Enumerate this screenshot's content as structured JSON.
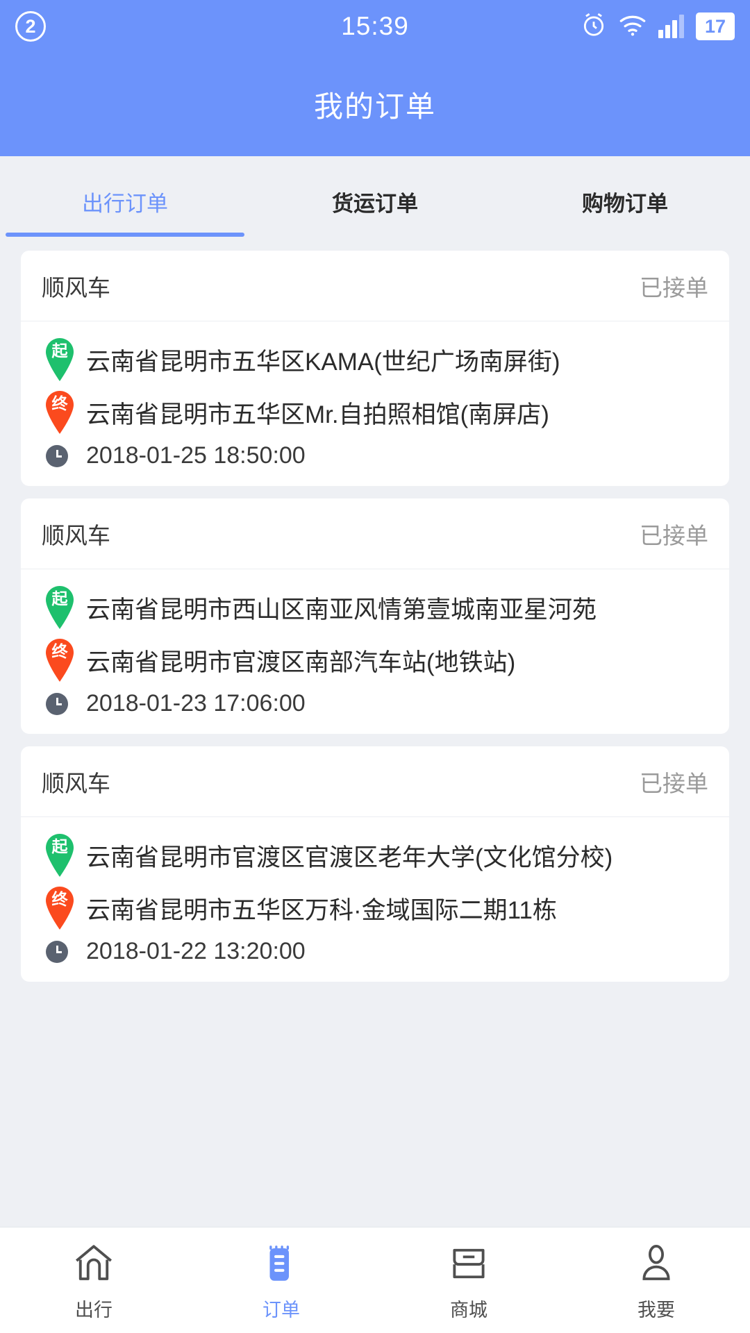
{
  "colors": {
    "brand": "#6c93fb",
    "page_bg": "#eef0f4",
    "card_bg": "#ffffff",
    "start_pin": "#1ec06d",
    "end_pin": "#fb4a1e",
    "muted_text": "#9a9a9a"
  },
  "statusbar": {
    "notification_count": "2",
    "time": "15:39",
    "battery": "17",
    "icons": [
      "alarm-icon",
      "wifi-icon",
      "signal-icon",
      "battery-icon"
    ]
  },
  "header": {
    "title": "我的订单"
  },
  "tabs": [
    {
      "label": "出行订单",
      "active": true
    },
    {
      "label": "货运订单",
      "active": false
    },
    {
      "label": "购物订单",
      "active": false
    }
  ],
  "orders": [
    {
      "type": "顺风车",
      "status": "已接单",
      "start_badge": "起",
      "end_badge": "终",
      "start_address": "云南省昆明市五华区KAMA(世纪广场南屏街)",
      "end_address": "云南省昆明市五华区Mr.自拍照相馆(南屏店)",
      "time": "2018-01-25 18:50:00"
    },
    {
      "type": "顺风车",
      "status": "已接单",
      "start_badge": "起",
      "end_badge": "终",
      "start_address": "云南省昆明市西山区南亚风情第壹城南亚星河苑",
      "end_address": "云南省昆明市官渡区南部汽车站(地铁站)",
      "time": "2018-01-23 17:06:00"
    },
    {
      "type": "顺风车",
      "status": "已接单",
      "start_badge": "起",
      "end_badge": "终",
      "start_address": "云南省昆明市官渡区官渡区老年大学(文化馆分校)",
      "end_address": "云南省昆明市五华区万科·金域国际二期11栋",
      "time": "2018-01-22 13:20:00"
    }
  ],
  "bottomnav": [
    {
      "label": "出行",
      "icon": "home-icon",
      "active": false
    },
    {
      "label": "订单",
      "icon": "order-list-icon",
      "active": true
    },
    {
      "label": "商城",
      "icon": "store-icon",
      "active": false
    },
    {
      "label": "我要",
      "icon": "person-icon",
      "active": false
    }
  ]
}
